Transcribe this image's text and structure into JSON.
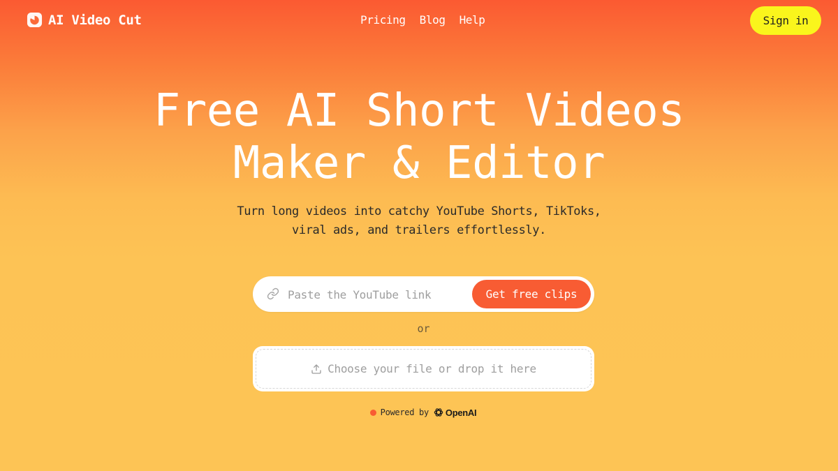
{
  "nav": {
    "brand": "AI Video Cut",
    "links": [
      "Pricing",
      "Blog",
      "Help"
    ],
    "sign_in": "Sign in"
  },
  "hero": {
    "title_lines": [
      "Free AI Short Videos",
      "Maker & Editor"
    ],
    "subtitle_lines": [
      "Turn long videos into catchy YouTube Shorts, TikToks,",
      "viral ads, and trailers effortlessly."
    ]
  },
  "link_form": {
    "placeholder": "Paste the YouTube link",
    "value": "",
    "button": "Get free clips"
  },
  "separator": "or",
  "upload": {
    "label": "Choose your file or drop it here"
  },
  "powered": {
    "label": "Powered by",
    "provider": "OpenAI"
  },
  "colors": {
    "accent": "#f85c33",
    "signin_bg": "#faf51c",
    "gradient_top": "#fb5a32",
    "gradient_bottom": "#fdc455"
  },
  "icons": {
    "brand": "brand-logo-icon",
    "link": "link-icon",
    "upload": "upload-icon",
    "provider": "openai-logo-icon"
  }
}
